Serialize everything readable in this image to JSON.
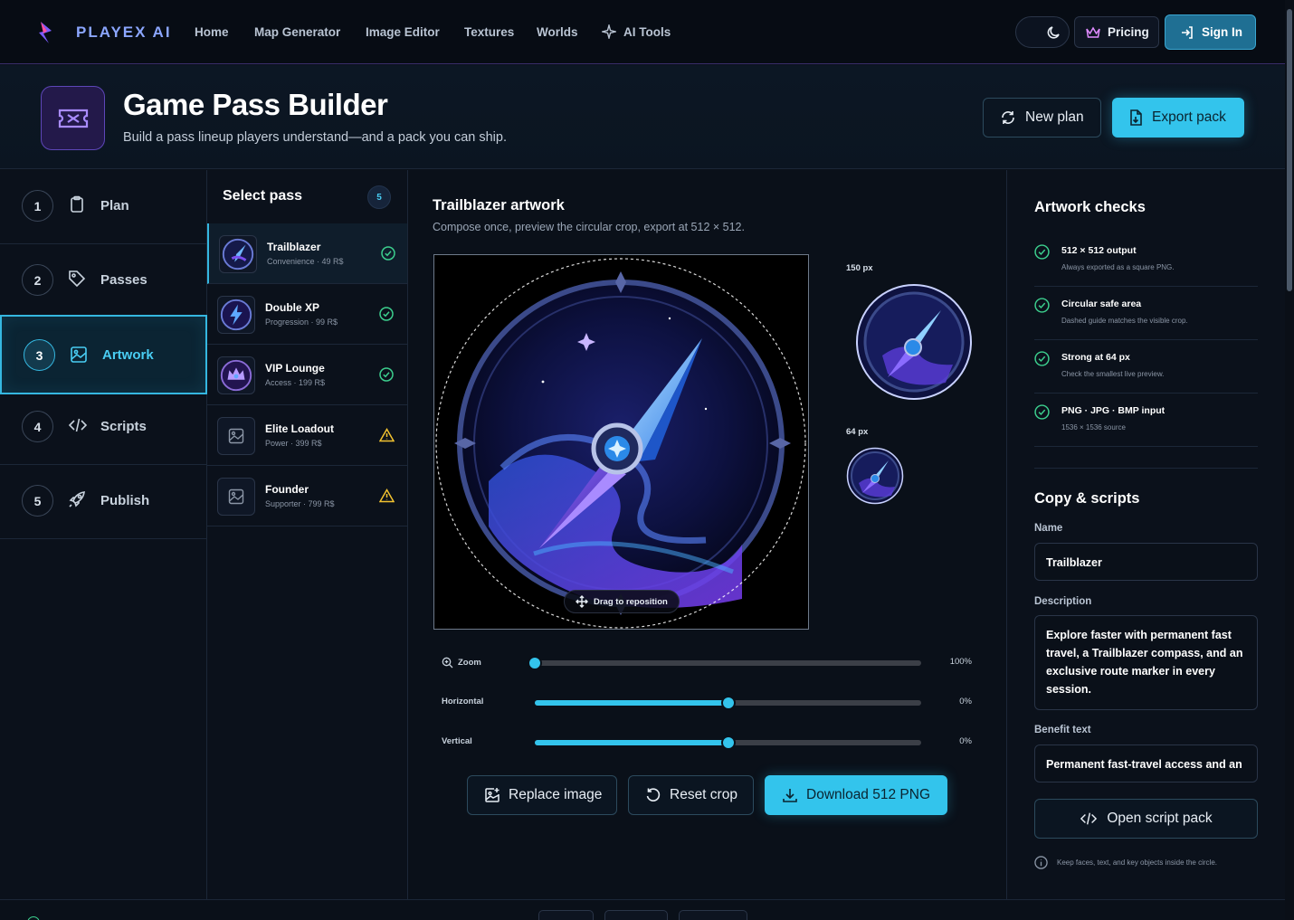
{
  "brand": {
    "name": "PLAYEX AI"
  },
  "nav": {
    "links": [
      "Home",
      "Map Generator",
      "Image Editor",
      "Textures",
      "Worlds",
      "AI Tools"
    ],
    "pricing": "Pricing",
    "sign_in": "Sign In"
  },
  "header": {
    "title": "Game Pass Builder",
    "subtitle": "Build a pass lineup players understand—and a pack you can ship.",
    "new_plan": "New plan",
    "export_pack": "Export pack"
  },
  "steps": [
    {
      "num": "1",
      "label": "Plan",
      "icon": "clipboard-icon"
    },
    {
      "num": "2",
      "label": "Passes",
      "icon": "tag-icon"
    },
    {
      "num": "3",
      "label": "Artwork",
      "icon": "image-icon",
      "active": true
    },
    {
      "num": "4",
      "label": "Scripts",
      "icon": "code-icon"
    },
    {
      "num": "5",
      "label": "Publish",
      "icon": "rocket-icon"
    }
  ],
  "passes": {
    "title": "Select pass",
    "count": "5",
    "items": [
      {
        "name": "Trailblazer",
        "meta": "Convenience · 49 R$",
        "status": "ok"
      },
      {
        "name": "Double XP",
        "meta": "Progression · 99 R$",
        "status": "ok"
      },
      {
        "name": "VIP Lounge",
        "meta": "Access · 199 R$",
        "status": "ok"
      },
      {
        "name": "Elite Loadout",
        "meta": "Power · 399 R$",
        "status": "warning"
      },
      {
        "name": "Founder",
        "meta": "Supporter · 799 R$",
        "status": "warning"
      }
    ]
  },
  "artwork": {
    "title": "Trailblazer artwork",
    "subtitle": "Compose once, preview the circular crop, export at 512 × 512.",
    "drag_hint": "Drag to reposition",
    "preview_large": "150 px",
    "preview_small": "64 px",
    "sliders": [
      {
        "label": "Zoom",
        "value": "100%",
        "level": 0.0,
        "filled": false
      },
      {
        "label": "Horizontal",
        "value": "0%",
        "level": 0.5,
        "filled": true
      },
      {
        "label": "Vertical",
        "value": "0%",
        "level": 0.5,
        "filled": true
      }
    ],
    "replace_image": "Replace image",
    "reset_crop": "Reset crop",
    "download": "Download 512 PNG"
  },
  "checks": {
    "title": "Artwork checks",
    "items": [
      {
        "title": "512 × 512 output",
        "sub": "Always exported as a square PNG."
      },
      {
        "title": "Circular safe area",
        "sub": "Dashed guide matches the visible crop."
      },
      {
        "title": "Strong at 64 px",
        "sub": "Check the smallest live preview."
      },
      {
        "title": "PNG · JPG · BMP input",
        "sub": "1536 × 1536 source"
      }
    ]
  },
  "copy": {
    "title": "Copy & scripts",
    "name_label": "Name",
    "name_value": "Trailblazer",
    "description_label": "Description",
    "description_value": "Explore faster with permanent fast travel, a Trailblazer compass, and an exclusive route marker in every session.",
    "benefit_label": "Benefit text",
    "benefit_value": "Permanent fast-travel access and an",
    "open_script": "Open script pack",
    "hint": "Keep faces, text, and key objects inside the circle."
  },
  "colors": {
    "accent": "#33c4ec",
    "brand": "#8ba6ff",
    "ok": "#3ccf8e",
    "warning": "#f2c230"
  }
}
